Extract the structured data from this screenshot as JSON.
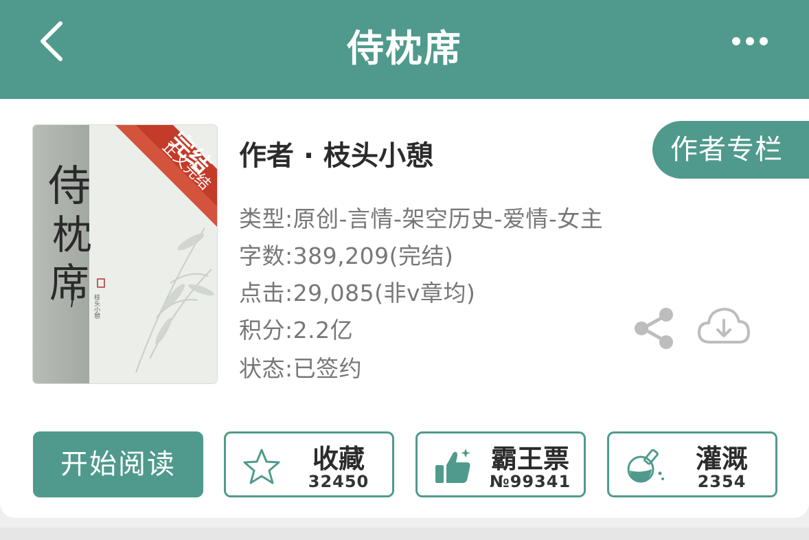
{
  "header": {
    "title": "侍枕席",
    "back_icon": "chevron-left-icon",
    "more_icon": "more-dots-icon",
    "color": "#4f9a8c"
  },
  "cover": {
    "title_text": "侍枕席",
    "ribbon_text": "完结",
    "ribbon_sub": "正文完结",
    "author_small": "枝头小憩 著"
  },
  "book": {
    "author": "作者 · 枝头小憩",
    "author_column_button": "作者专栏",
    "genre": "类型:原创-言情-架空历史-爱情-女主",
    "word_count": "字数:389,209(完结)",
    "clicks": "点击:29,085(非v章均)",
    "points": "积分:2.2亿",
    "status": "状态:已签约"
  },
  "actions": {
    "read_label": "开始阅读",
    "favorite": {
      "label": "收藏",
      "count": "32450",
      "icon": "star-icon"
    },
    "ticket": {
      "label": "霸王票",
      "count": "№99341",
      "icon": "thumbs-up-icon"
    },
    "water": {
      "label": "灌溉",
      "count": "2354",
      "icon": "watering-flask-icon"
    }
  },
  "icons": {
    "share": "share-icon",
    "download": "cloud-download-icon"
  }
}
